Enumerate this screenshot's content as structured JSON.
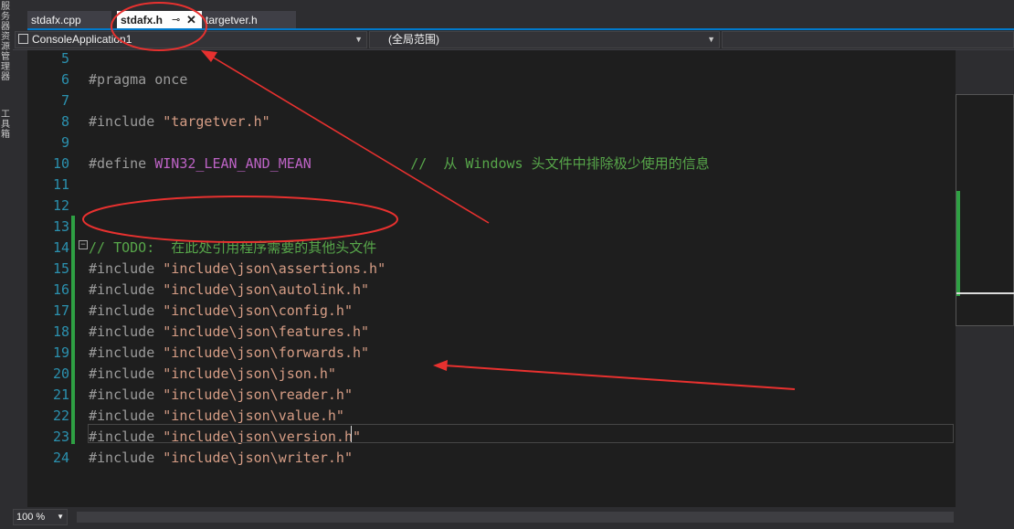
{
  "left_toolbar": {
    "labels": [
      "服务器资源管理器",
      "工具箱"
    ]
  },
  "tabs": [
    {
      "label": "stdafx.cpp",
      "active": false
    },
    {
      "label": "stdafx.h",
      "active": true
    },
    {
      "label": "targetver.h",
      "active": false
    }
  ],
  "navbar": {
    "project": "ConsoleApplication1",
    "scope": "(全局范围)"
  },
  "editor": {
    "lines": [
      {
        "num": "5"
      },
      {
        "num": "6",
        "tokens": [
          {
            "t": "#pragma once",
            "c": "kw-pre"
          }
        ]
      },
      {
        "num": "7"
      },
      {
        "num": "8",
        "tokens": [
          {
            "t": "#include ",
            "c": "kw-pre"
          },
          {
            "t": "\"targetver.h\"",
            "c": "str"
          }
        ]
      },
      {
        "num": "9"
      },
      {
        "num": "10",
        "tokens": [
          {
            "t": "#define ",
            "c": "kw-pre"
          },
          {
            "t": "WIN32_LEAN_AND_MEAN",
            "c": "macro"
          },
          {
            "t": "            ",
            "c": "plain"
          },
          {
            "t": "//  从 Windows 头文件中排除极少使用的信息",
            "c": "cmt"
          }
        ]
      },
      {
        "num": "11"
      },
      {
        "num": "12"
      },
      {
        "num": "13"
      },
      {
        "num": "14",
        "tokens": [
          {
            "t": "// TODO:  在此处引用程序需要的其他头文件",
            "c": "cmt"
          }
        ]
      },
      {
        "num": "15",
        "tokens": [
          {
            "t": "#include ",
            "c": "kw-pre"
          },
          {
            "t": "\"include\\json\\assertions.h\"",
            "c": "str"
          }
        ]
      },
      {
        "num": "16",
        "tokens": [
          {
            "t": "#include ",
            "c": "kw-pre"
          },
          {
            "t": "\"include\\json\\autolink.h\"",
            "c": "str"
          }
        ]
      },
      {
        "num": "17",
        "tokens": [
          {
            "t": "#include ",
            "c": "kw-pre"
          },
          {
            "t": "\"include\\json\\config.h\"",
            "c": "str"
          }
        ]
      },
      {
        "num": "18",
        "tokens": [
          {
            "t": "#include ",
            "c": "kw-pre"
          },
          {
            "t": "\"include\\json\\features.h\"",
            "c": "str"
          }
        ]
      },
      {
        "num": "19",
        "tokens": [
          {
            "t": "#include ",
            "c": "kw-pre"
          },
          {
            "t": "\"include\\json\\forwards.h\"",
            "c": "str"
          }
        ]
      },
      {
        "num": "20",
        "tokens": [
          {
            "t": "#include ",
            "c": "kw-pre"
          },
          {
            "t": "\"include\\json\\json.h\"",
            "c": "str"
          }
        ]
      },
      {
        "num": "21",
        "tokens": [
          {
            "t": "#include ",
            "c": "kw-pre"
          },
          {
            "t": "\"include\\json\\reader.h\"",
            "c": "str"
          }
        ]
      },
      {
        "num": "22",
        "tokens": [
          {
            "t": "#include ",
            "c": "kw-pre"
          },
          {
            "t": "\"include\\json\\value.h\"",
            "c": "str"
          }
        ]
      },
      {
        "num": "23",
        "tokens": [
          {
            "t": "#include ",
            "c": "kw-pre"
          },
          {
            "t": "\"include\\json\\version.h\"",
            "c": "str"
          }
        ]
      },
      {
        "num": "24",
        "tokens": [
          {
            "t": "#include ",
            "c": "kw-pre"
          },
          {
            "t": "\"include\\json\\writer.h\"",
            "c": "str"
          }
        ]
      }
    ]
  },
  "statusbar": {
    "zoom": "100 %"
  },
  "colors": {
    "accent": "#007acc",
    "annotation": "#e8312f",
    "changed": "#2ea043"
  }
}
